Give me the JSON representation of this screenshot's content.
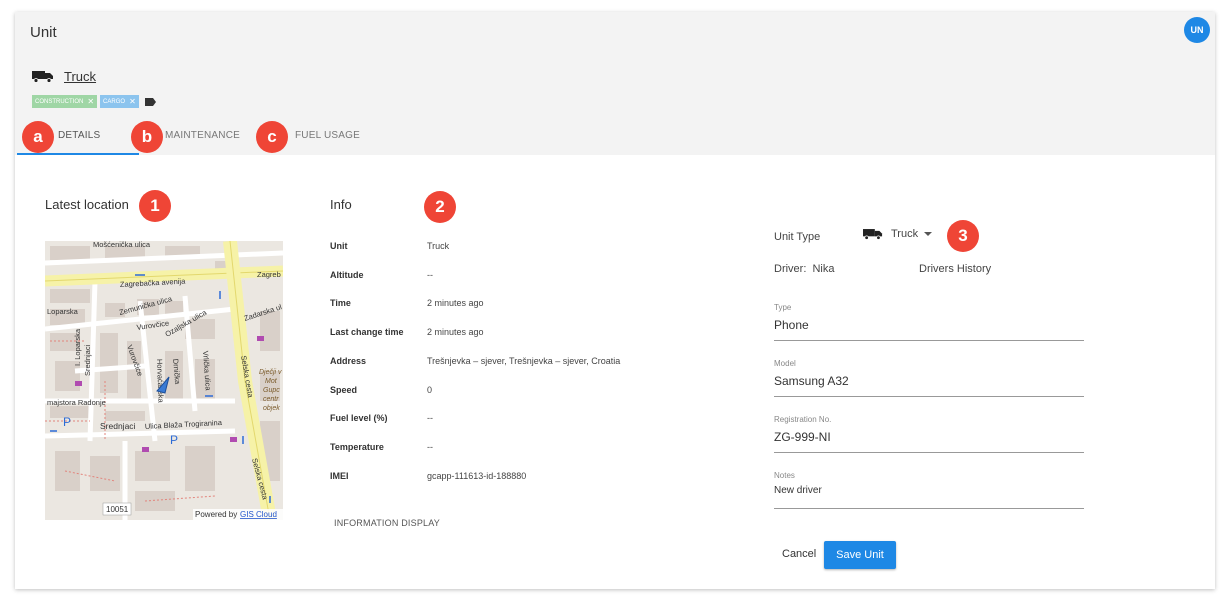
{
  "window": {
    "title": "Unit",
    "avatar_initials": "UN"
  },
  "unit": {
    "name": "Truck",
    "icon": "truck-icon",
    "tags": [
      {
        "label": "CONSTRUCTION",
        "color": "#9fd6a5"
      },
      {
        "label": "CARGO",
        "color": "#8cc4ee"
      }
    ]
  },
  "tabs": [
    {
      "label": "DETAILS",
      "badge": "a",
      "active": true
    },
    {
      "label": "MAINTENANCE",
      "badge": "b"
    },
    {
      "label": "FUEL USAGE",
      "badge": "c"
    }
  ],
  "latest_location": {
    "title": "Latest location",
    "badge": "1",
    "map": {
      "streets": [
        "Mošćenička ulica",
        "Zagrebačka avenija",
        "Zagreb",
        "Zemunička ulica",
        "Vurovčice",
        "Ozaljska ulica",
        "Zadarska ul",
        "Loparska",
        "Srednjaci",
        "Vurovčice",
        "Horvaćanska",
        "Drnička",
        "Vrlička ulica",
        "Selska cesta",
        "majstora Radonje",
        "Srednjaci",
        "Ulica Blaža Trogiranina",
        "Selska cesta",
        "I. Loparska"
      ],
      "poi": [
        "Dječji v",
        "Mot",
        "Gupc",
        "centr",
        "objek"
      ],
      "parking": [
        "P",
        "P"
      ],
      "house_number": "10051",
      "attribution_prefix": "Powered by",
      "attribution_link": "GIS Cloud"
    }
  },
  "info": {
    "title": "Info",
    "badge": "2",
    "rows": [
      {
        "label": "Unit",
        "value": "Truck"
      },
      {
        "label": "Altitude",
        "value": "--"
      },
      {
        "label": "Time",
        "value": "2 minutes ago"
      },
      {
        "label": "Last change time",
        "value": "2 minutes ago"
      },
      {
        "label": "Address",
        "value": "Trešnjevka – sjever, Trešnjevka – sjever, Croatia"
      },
      {
        "label": "Speed",
        "value": "0"
      },
      {
        "label": "Fuel level (%)",
        "value": "--"
      },
      {
        "label": "Temperature",
        "value": "--"
      },
      {
        "label": "IMEI",
        "value": "gcapp-111613-id-188880"
      }
    ],
    "display_link": "INFORMATION DISPLAY"
  },
  "form": {
    "badge": "3",
    "unit_type_label": "Unit Type",
    "unit_type_value": "Truck",
    "driver_label": "Driver:",
    "driver_name": "Nika",
    "drivers_history": "Drivers History",
    "fields": [
      {
        "label": "Type",
        "value": "Phone"
      },
      {
        "label": "Model",
        "value": "Samsung A32"
      },
      {
        "label": "Registration No.",
        "value": "ZG-999-NI"
      },
      {
        "label": "Notes",
        "value": "New driver"
      }
    ],
    "cancel": "Cancel",
    "save": "Save Unit"
  },
  "colors": {
    "accent": "#1e88e5",
    "badge": "#ef4536",
    "header_bg": "#f3f3f3"
  }
}
